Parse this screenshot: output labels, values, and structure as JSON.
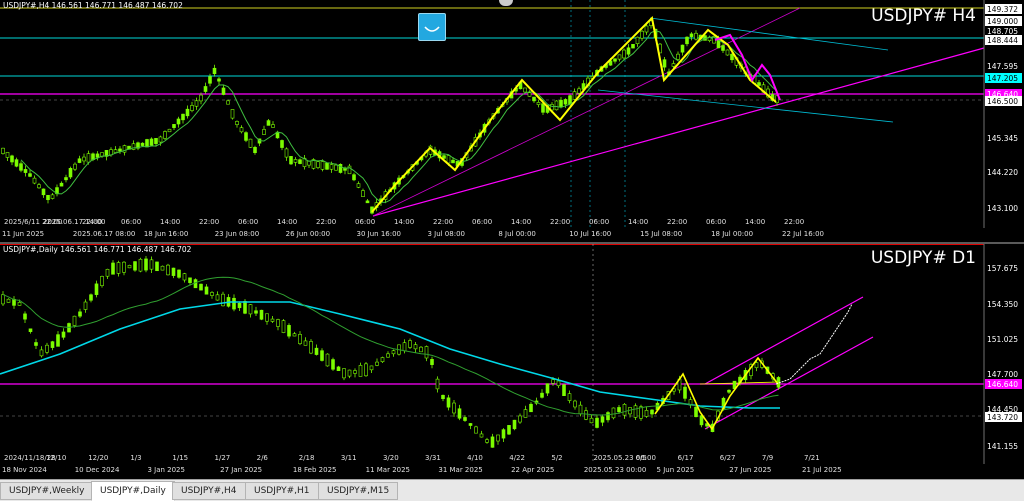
{
  "h4": {
    "header": "USDJPY#,H4  146.561 146.771 146.487 146.702",
    "symbol": "USDJPY# H4",
    "prices": [
      {
        "label": "149.372",
        "bg": "#ffffff",
        "fg": "#000"
      },
      {
        "label": "149.000",
        "bg": "#ffffff",
        "fg": "#000"
      },
      {
        "label": "148.705",
        "bg": "#000000",
        "fg": "#fff"
      },
      {
        "label": "148.444",
        "bg": "#ffffff",
        "fg": "#000"
      },
      {
        "label": "147.595",
        "bg": "#000000",
        "fg": "#fff"
      },
      {
        "label": "147.205",
        "bg": "#00ffff",
        "fg": "#000"
      },
      {
        "label": "146.640",
        "bg": "#ff00ff",
        "fg": "#fff"
      },
      {
        "label": "146.500",
        "bg": "#ffffff",
        "fg": "#000"
      },
      {
        "label": "145.345",
        "bg": "#000000",
        "fg": "#fff"
      },
      {
        "label": "144.220",
        "bg": "#000000",
        "fg": "#fff"
      },
      {
        "label": "143.100",
        "bg": "#000000",
        "fg": "#fff"
      }
    ],
    "time_labels": [
      "2025/6/11 22:00",
      "2025.06.17 14:00",
      "22:00",
      "06:00",
      "14:00",
      "22:00",
      "06:00",
      "14:00",
      "22:00",
      "06:00",
      "14:00",
      "22:00",
      "06:00",
      "14:00",
      "22:00",
      "06:00",
      "14:00",
      "22:00",
      "06:00",
      "14:00",
      "22:00"
    ],
    "date_labels": [
      "11 Jun 2025",
      "2025.06.17 08:00",
      "18 Jun 16:00",
      "23 Jun 08:00",
      "26 Jun 00:00",
      "30 Jun 16:00",
      "3 Jul 08:00",
      "8 Jul 00:00",
      "10 Jul 16:00",
      "15 Jul 08:00",
      "18 Jul 00:00",
      "22 Jul 16:00"
    ]
  },
  "d1": {
    "header": "USDJPY#,Daily  146.561 146.771 146.487 146.702",
    "symbol": "USDJPY# D1",
    "prices": [
      {
        "label": "157.675",
        "bg": "#000000",
        "fg": "#fff"
      },
      {
        "label": "154.350",
        "bg": "#000000",
        "fg": "#fff"
      },
      {
        "label": "151.025",
        "bg": "#000000",
        "fg": "#fff"
      },
      {
        "label": "147.700",
        "bg": "#000000",
        "fg": "#fff"
      },
      {
        "label": "146.640",
        "bg": "#ff00ff",
        "fg": "#fff"
      },
      {
        "label": "144.450",
        "bg": "#000000",
        "fg": "#fff"
      },
      {
        "label": "143.720",
        "bg": "#ffffff",
        "fg": "#000"
      },
      {
        "label": "141.155",
        "bg": "#000000",
        "fg": "#fff"
      }
    ],
    "time_labels": [
      "2024/11/18/28",
      "12/10",
      "12/20",
      "1/3",
      "1/15",
      "1/27",
      "2/6",
      "2/18",
      "3/11",
      "3/20",
      "3/31",
      "4/10",
      "4/22",
      "5/2",
      "2025.05.23 06:00",
      "6/5",
      "6/17",
      "6/27",
      "7/9",
      "7/21"
    ],
    "date_labels": [
      "18 Nov 2024",
      "10 Dec 2024",
      "3 Jan 2025",
      "27 Jan 2025",
      "18 Feb 2025",
      "11 Mar 2025",
      "31 Mar 2025",
      "22 Apr 2025",
      "2025.05.23 00:00",
      "5 Jun 2025",
      "27 Jun 2025",
      "21 Jul 2025"
    ]
  },
  "tabs": [
    "USDJPY#,Weekly",
    "USDJPY#,Daily",
    "USDJPY#,H4",
    "USDJPY#,H1",
    "USDJPY#,M15"
  ],
  "active_tab": "USDJPY#,Daily"
}
